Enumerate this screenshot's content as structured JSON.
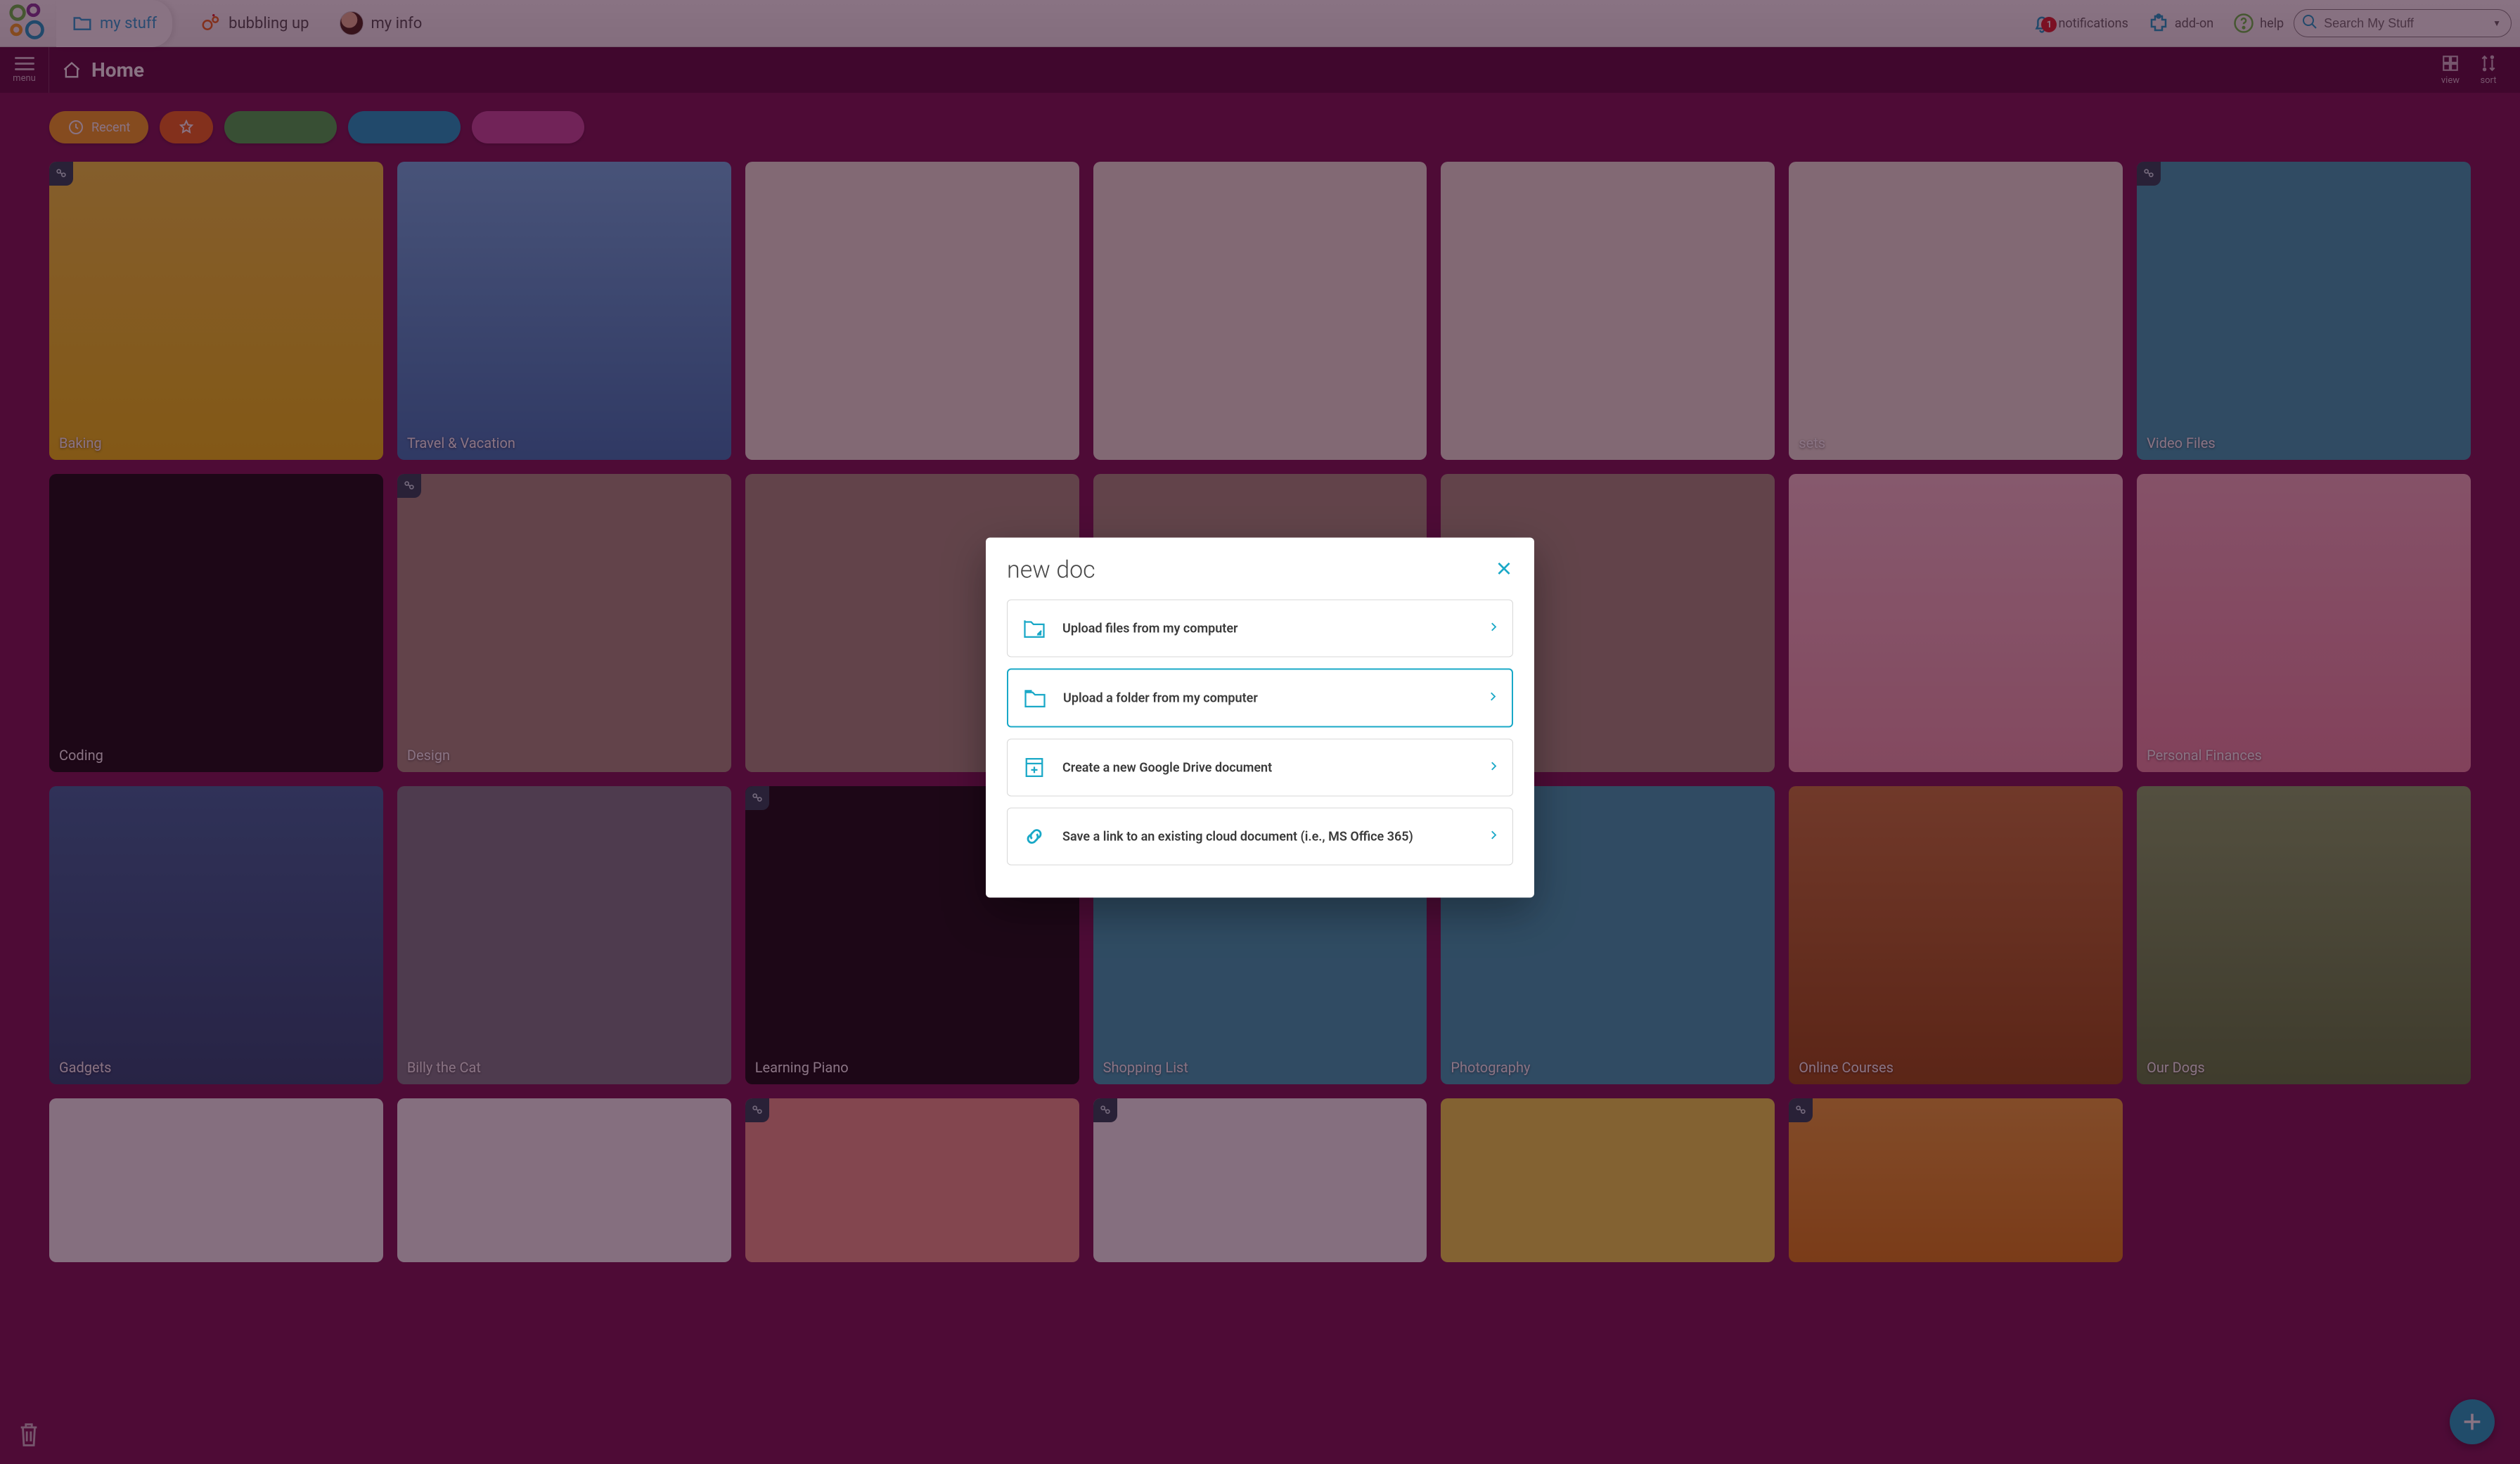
{
  "topnav": {
    "tabs": {
      "mystuff": "my stuff",
      "bubbling": "bubbling up",
      "myinfo": "my info"
    },
    "notifications_label": "notifications",
    "notifications_count": "1",
    "addon_label": "add-on",
    "help_label": "help",
    "search_placeholder": "Search My Stuff"
  },
  "header": {
    "menu_label": "menu",
    "title": "Home",
    "view_label": "view",
    "sort_label": "sort"
  },
  "pills": {
    "recent": "Recent"
  },
  "tiles": {
    "r1": [
      "Baking",
      "Travel & Vacation",
      "",
      "",
      "",
      "sets",
      "Video Files"
    ],
    "r2": [
      "Coding",
      "Design",
      "",
      "",
      "",
      "",
      "Personal Finances"
    ],
    "r3": [
      "Gadgets",
      "Billy the Cat",
      "Learning Piano",
      "Shopping List",
      "Photography",
      "Online Courses",
      "Our Dogs"
    ]
  },
  "modal": {
    "title": "new doc",
    "opt1": "Upload files from my computer",
    "opt2": "Upload a folder from my computer",
    "opt3": "Create a new Google Drive document",
    "opt4": "Save a link to an existing cloud document (i.e., MS Office 365)"
  }
}
